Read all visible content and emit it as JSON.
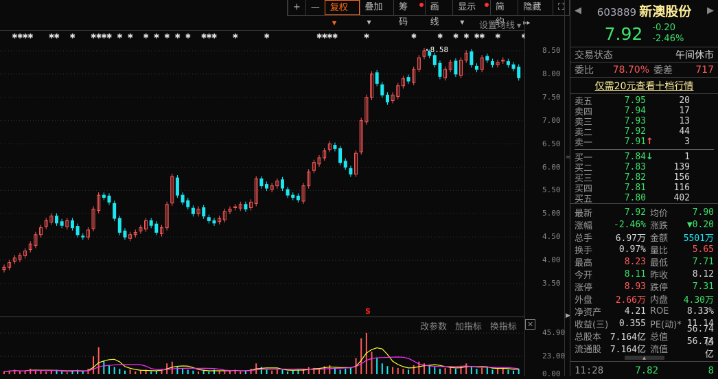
{
  "toolbar": {
    "zoom_in": "+",
    "zoom_out": "—",
    "fuquan": "复权",
    "overlay": "叠加",
    "chips": "筹码",
    "draw": "画线",
    "display": "显示",
    "simple": "简约",
    "hide": "隐藏",
    "hide_arrow": "▸▸",
    "fullscreen": "⛶"
  },
  "main": {
    "ma_settings": "设置均线",
    "peak_label": "8.58",
    "split_marker": "S",
    "indicator_buttons": {
      "params": "改参数",
      "add": "加指标",
      "switch": "换指标",
      "close": "✕"
    }
  },
  "price_axis": [
    "8.50",
    "8.00",
    "7.50",
    "7.00",
    "6.50",
    "6.00",
    "5.50",
    "5.00",
    "4.50",
    "4.00",
    "3.50"
  ],
  "volume_axis": [
    "45.90",
    "23.00",
    "0.00"
  ],
  "chart_data": {
    "type": "candlestick",
    "up_color": "#ff5a5a",
    "down_color": "#1ee6f0",
    "ylim": [
      3.5,
      8.5
    ],
    "closes": [
      3.85,
      3.95,
      4.05,
      4.1,
      4.2,
      4.35,
      4.55,
      4.7,
      4.85,
      4.95,
      4.8,
      4.75,
      4.85,
      4.7,
      4.55,
      4.5,
      4.65,
      5.1,
      5.4,
      5.35,
      5.25,
      4.9,
      4.6,
      4.5,
      4.55,
      4.6,
      4.7,
      4.85,
      4.75,
      4.6,
      4.7,
      5.2,
      5.8,
      5.4,
      5.25,
      5.15,
      5.0,
      5.1,
      4.95,
      4.85,
      4.8,
      4.9,
      5.05,
      5.1,
      5.15,
      5.2,
      5.1,
      5.25,
      5.75,
      5.6,
      5.55,
      5.6,
      5.7,
      5.55,
      5.4,
      5.35,
      5.3,
      5.6,
      5.9,
      6.1,
      6.2,
      6.35,
      6.5,
      6.4,
      6.1,
      6.0,
      5.85,
      6.3,
      7.0,
      7.5,
      8.0,
      7.8,
      7.55,
      7.4,
      7.55,
      7.75,
      7.9,
      7.85,
      8.1,
      8.35,
      8.5,
      8.4,
      8.2,
      7.95,
      8.1,
      8.25,
      8.0,
      8.3,
      8.45,
      8.2,
      8.1,
      8.35,
      8.3,
      8.2,
      8.25,
      8.3,
      8.2,
      8.12,
      7.92
    ],
    "volumes": [
      3,
      4,
      5,
      3,
      4,
      6,
      5,
      4,
      3,
      4,
      5,
      3,
      2,
      4,
      5,
      3,
      6,
      20,
      30,
      15,
      10,
      8,
      6,
      4,
      5,
      3,
      4,
      5,
      3,
      4,
      6,
      12,
      14,
      8,
      6,
      5,
      4,
      3,
      4,
      3,
      5,
      4,
      3,
      4,
      5,
      3,
      4,
      6,
      12,
      8,
      5,
      4,
      6,
      5,
      3,
      4,
      5,
      6,
      8,
      7,
      6,
      9,
      10,
      7,
      5,
      6,
      8,
      18,
      40,
      46,
      25,
      18,
      12,
      9,
      8,
      7,
      6,
      5,
      10,
      14,
      12,
      9,
      8,
      6,
      7,
      8,
      6,
      9,
      12,
      8,
      6,
      7,
      8,
      5,
      6,
      7,
      5,
      4,
      6
    ],
    "volume_ylim": [
      0,
      45.9
    ],
    "marker_indices": [
      2,
      3,
      4,
      5,
      9,
      10,
      13,
      17,
      18,
      19,
      20,
      22,
      24,
      27,
      29,
      31,
      33,
      35,
      38,
      39,
      40,
      44,
      50,
      60,
      61,
      62,
      63,
      69,
      78,
      83,
      86,
      88,
      90,
      91,
      94,
      99
    ]
  },
  "quote": {
    "code": "603889",
    "name": "新澳股份",
    "price": "7.92",
    "change": "-0.20",
    "change_pct": "-2.46%"
  },
  "status": {
    "label": "交易状态",
    "value": "午间休市"
  },
  "wei": {
    "ratio_label": "委比",
    "ratio": "78.70%",
    "diff_label": "委差",
    "diff": "717"
  },
  "promo": "仅需20元查看十档行情",
  "asks": [
    {
      "label": "卖五",
      "price": "7.95",
      "vol": "20"
    },
    {
      "label": "卖四",
      "price": "7.94",
      "vol": "17"
    },
    {
      "label": "卖三",
      "price": "7.93",
      "vol": "13"
    },
    {
      "label": "卖二",
      "price": "7.92",
      "vol": "44"
    },
    {
      "label": "卖一",
      "price": "7.91",
      "vol": "3",
      "arrow": "↑"
    }
  ],
  "bids": [
    {
      "label": "买一",
      "price": "7.84",
      "vol": "1",
      "arrow": "↓"
    },
    {
      "label": "买二",
      "price": "7.83",
      "vol": "139"
    },
    {
      "label": "买三",
      "price": "7.82",
      "vol": "156"
    },
    {
      "label": "买四",
      "price": "7.81",
      "vol": "116"
    },
    {
      "label": "买五",
      "price": "7.80",
      "vol": "402"
    }
  ],
  "stats": [
    [
      "最新",
      "7.92",
      "g",
      "均价",
      "7.90",
      "g"
    ],
    [
      "涨幅",
      "-2.46%",
      "g",
      "涨跌",
      "▼0.20",
      "g"
    ],
    [
      "总手",
      "6.97万",
      "w",
      "金额",
      "5501万",
      "c"
    ],
    [
      "换手",
      "0.97%",
      "w",
      "量比",
      "5.65",
      "r"
    ],
    [
      "最高",
      "8.23",
      "r",
      "最低",
      "7.71",
      "g"
    ],
    [
      "今开",
      "8.11",
      "g",
      "昨收",
      "8.12",
      "w"
    ],
    [
      "涨停",
      "8.93",
      "r",
      "跌停",
      "7.31",
      "g"
    ],
    [
      "外盘",
      "2.66万",
      "r",
      "内盘",
      "4.30万",
      "g"
    ],
    [
      "净资产",
      "4.21",
      "w",
      "ROE",
      "8.33%",
      "w"
    ],
    [
      "收益(三)",
      "0.355",
      "w",
      "PE(动)*",
      "11.14",
      "w"
    ],
    [
      "总股本",
      "7.164亿",
      "w",
      "总值",
      "56.74亿",
      "w"
    ],
    [
      "流通股",
      "7.164亿",
      "w",
      "流值",
      "56.74亿",
      "w"
    ]
  ],
  "tick": {
    "time": "11:28",
    "price": "7.82",
    "vol": "8"
  }
}
